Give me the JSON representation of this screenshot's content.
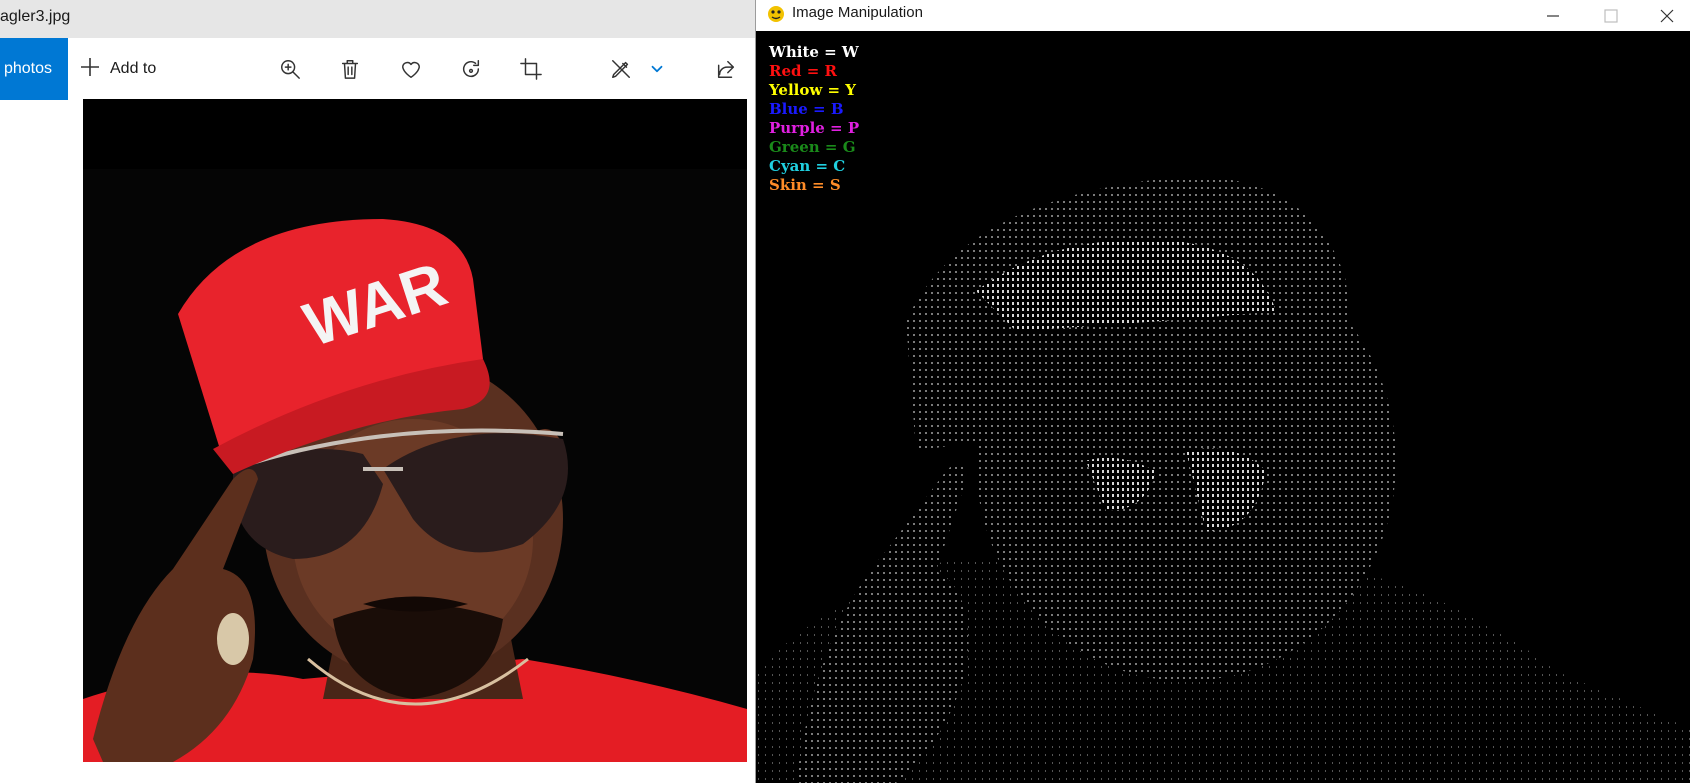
{
  "photos": {
    "title": "agler3.jpg",
    "toolbar": {
      "all_photos_label": "l photos",
      "add_to_label": "Add to"
    },
    "icons": {
      "zoom": "zoom-in-icon",
      "delete": "trash-icon",
      "favorite": "heart-icon",
      "rotate": "rotate-icon",
      "crop": "crop-icon",
      "edit": "edit-draw-icon",
      "share": "share-icon"
    },
    "image": {
      "cap_text": "WAR"
    }
  },
  "pygame": {
    "title": "Image Manipulation",
    "legend": [
      {
        "label": "White = W",
        "color": "#ffffff"
      },
      {
        "label": "Red = R",
        "color": "#ff1010"
      },
      {
        "label": "Yellow = Y",
        "color": "#ffff00"
      },
      {
        "label": "Blue = B",
        "color": "#1a1aff"
      },
      {
        "label": "Purple = P",
        "color": "#e020e0"
      },
      {
        "label": "Green = G",
        "color": "#1a8a1a"
      },
      {
        "label": "Cyan = C",
        "color": "#20d0e0"
      },
      {
        "label": "Skin = S",
        "color": "#ff8c28"
      }
    ]
  },
  "colors": {
    "accent": "#0078d4",
    "titlebar_bg": "#e6e6e6",
    "cap_red": "#e8232c"
  }
}
